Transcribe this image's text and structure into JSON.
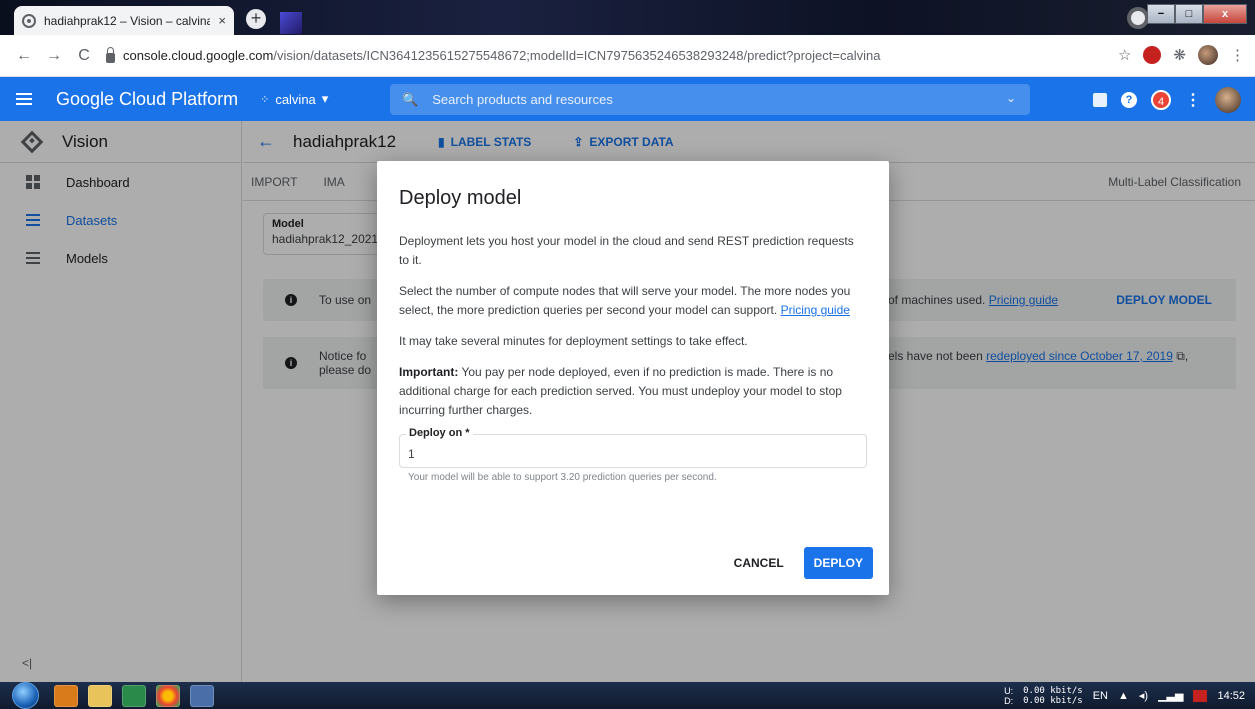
{
  "browser": {
    "tab_title": "hadiahprak12 – Vision – calvina -",
    "tab_close": "×",
    "new_tab": "+",
    "url_host": "console.cloud.google.com",
    "url_path": "/vision/datasets/ICN3641235615275548672;modelId=ICN7975635246538293248/predict?project=calvina",
    "back": "←",
    "forward": "→",
    "reload": "C",
    "star": "☆",
    "puzzle": "❋",
    "menu": "⋮",
    "win_min": "−",
    "win_max": "□",
    "win_close": "x"
  },
  "header": {
    "title": "Google Cloud Platform",
    "project": "calvina",
    "project_dots": "⁘",
    "project_chevron": "▾",
    "search_icon": "🔍",
    "search_placeholder": "Search products and resources",
    "search_chevron": "⌄",
    "help": "?",
    "notifications": "4",
    "kebab": "⋮"
  },
  "sidebar": {
    "title": "Vision",
    "items": [
      {
        "label": "Dashboard",
        "active": false
      },
      {
        "label": "Datasets",
        "active": true
      },
      {
        "label": "Models",
        "active": false
      }
    ],
    "collapse": "<|"
  },
  "main": {
    "back": "←",
    "dataset_name": "hadiahprak12",
    "label_stats": "LABEL STATS",
    "export_data": "EXPORT DATA",
    "tabs": [
      "IMPORT",
      "IMA"
    ],
    "classification": "Multi-Label Classification",
    "model_label": "Model",
    "model_value": "hadiahprak12_2021",
    "banner1_left": "To use on",
    "banner1_right": "of machines used.",
    "banner1_link": "Pricing guide",
    "deploy_model": "DEPLOY MODEL",
    "banner2_left_1": "Notice fo",
    "banner2_left_2": "please do",
    "banner2_right": "els have not been",
    "banner2_link": "redeployed since October 17, 2019",
    "banner2_link_icon": "⧉",
    "banner2_tail": ","
  },
  "dialog": {
    "title": "Deploy model",
    "p1": "Deployment lets you host your model in the cloud and send REST prediction requests to it.",
    "p2": "Select the number of compute nodes that will serve your model. The more nodes you select, the more prediction queries per second your model can support.",
    "p2_link": "Pricing guide",
    "p3": "It may take several minutes for deployment settings to take effect.",
    "p4_bold": "Important:",
    "p4": "You pay per node deployed, even if no prediction is made. There is no additional charge for each prediction served. You must undeploy your model to stop incurring further charges.",
    "field_label": "Deploy on *",
    "field_value": "1",
    "hint": "Your model will be able to support 3.20 prediction queries per second.",
    "cancel": "CANCEL",
    "deploy": "DEPLOY"
  },
  "taskbar": {
    "net_u_label": "U:",
    "net_d_label": "D:",
    "net_u": "0.00 kbit/s",
    "net_d": "0.00 kbit/s",
    "lang": "EN",
    "tray_up": "▲",
    "time": "14:52"
  }
}
